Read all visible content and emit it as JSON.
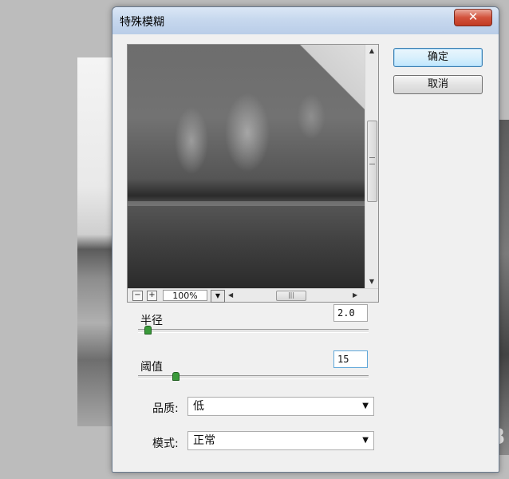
{
  "window": {
    "title": "特殊模糊",
    "close_glyph": "✕"
  },
  "preview": {
    "zoom_out": "−",
    "zoom_in": "+",
    "zoom_value": "100%",
    "zoom_dropdown": "▼",
    "scroll_up": "▲",
    "scroll_down": "▼",
    "scroll_left": "◀",
    "scroll_right": "▶",
    "hthumb_grip": "|||"
  },
  "buttons": {
    "ok": "确定",
    "cancel": "取消"
  },
  "params": {
    "radius": {
      "label": "半径",
      "value": "2.0",
      "slider_fraction": 0.03
    },
    "threshold": {
      "label": "阈值",
      "value": "15",
      "slider_fraction": 0.15
    }
  },
  "selects": {
    "quality": {
      "label": "品质:",
      "value": "低"
    },
    "mode": {
      "label": "模式:",
      "value": "正常"
    }
  },
  "colors": {
    "slider_thumb": "#3a9a3a",
    "default_button_border": "#3c7fb1",
    "close_button": "#c23b23"
  }
}
